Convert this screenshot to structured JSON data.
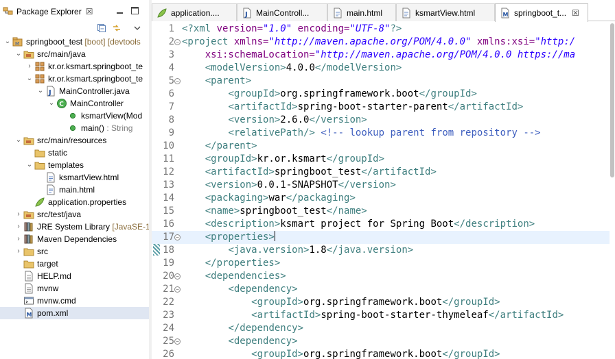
{
  "colors": {
    "tag": "#3f7f7f",
    "attr_name": "#7f007f",
    "attr_value": "#2a00ff",
    "comment": "#3f5fbf",
    "text": "#000000",
    "decoration": "#8a6d3b",
    "line_number": "#787878",
    "current_line": "#e8f2fe",
    "selected_row": "#dfe6f2"
  },
  "explorer": {
    "title": "Package Explorer",
    "close": "☒",
    "view_menu_icon": "view-menu-icon",
    "minimize_icon": "minimize-icon",
    "maximize_icon": "maximize-icon",
    "toolbar": {
      "collapse_all_icon": "collapse-all-icon",
      "link_editor_icon": "link-with-editor-icon",
      "menu_icon": "view-dropdown-icon"
    },
    "tree": [
      {
        "label": "springboot_test",
        "deco": " [boot] [devtools",
        "icon": "project-icon",
        "depth": 0,
        "twisty": "open"
      },
      {
        "label": "src/main/java",
        "icon": "source-folder-icon",
        "depth": 1,
        "twisty": "open"
      },
      {
        "label": "kr.or.ksmart.springboot_te",
        "icon": "package-icon",
        "depth": 2,
        "twisty": "closed"
      },
      {
        "label": "kr.or.ksmart.springboot_te",
        "icon": "package-icon",
        "depth": 2,
        "twisty": "open"
      },
      {
        "label": "MainController.java",
        "icon": "java-file-icon",
        "depth": 3,
        "twisty": "open"
      },
      {
        "label": "MainController",
        "icon": "class-icon",
        "depth": 4,
        "twisty": "open"
      },
      {
        "label": "ksmartView(Mod",
        "icon": "public-method-icon",
        "depth": 5,
        "twisty": "none"
      },
      {
        "label": "main()",
        "deco": " : String",
        "icon": "public-method-icon",
        "depth": 5,
        "twisty": "none"
      },
      {
        "label": "src/main/resources",
        "icon": "source-folder-icon",
        "depth": 1,
        "twisty": "open"
      },
      {
        "label": "static",
        "icon": "folder-icon",
        "depth": 2,
        "twisty": "none"
      },
      {
        "label": "templates",
        "icon": "folder-icon",
        "depth": 2,
        "twisty": "open"
      },
      {
        "label": "ksmartView.html",
        "icon": "html-file-icon",
        "depth": 3,
        "twisty": "none"
      },
      {
        "label": "main.html",
        "icon": "html-file-icon",
        "depth": 3,
        "twisty": "none"
      },
      {
        "label": "application.properties",
        "icon": "properties-file-icon",
        "depth": 2,
        "twisty": "none"
      },
      {
        "label": "src/test/java",
        "icon": "source-folder-icon",
        "depth": 1,
        "twisty": "closed"
      },
      {
        "label": "JRE System Library",
        "deco": " [JavaSE-1",
        "icon": "library-icon",
        "depth": 1,
        "twisty": "closed"
      },
      {
        "label": "Maven Dependencies",
        "icon": "library-icon",
        "depth": 1,
        "twisty": "closed"
      },
      {
        "label": "src",
        "icon": "folder-icon",
        "depth": 1,
        "twisty": "closed"
      },
      {
        "label": "target",
        "icon": "folder-icon",
        "depth": 1,
        "twisty": "none"
      },
      {
        "label": "HELP.md",
        "icon": "text-file-icon",
        "depth": 1,
        "twisty": "none"
      },
      {
        "label": "mvnw",
        "icon": "text-file-icon",
        "depth": 1,
        "twisty": "none"
      },
      {
        "label": "mvnw.cmd",
        "icon": "cmd-file-icon",
        "depth": 1,
        "twisty": "none"
      },
      {
        "label": "pom.xml",
        "icon": "xml-file-icon",
        "depth": 1,
        "twisty": "none",
        "selected": true
      }
    ]
  },
  "editor": {
    "tabs": [
      {
        "label": "application....",
        "icon": "properties-file-icon",
        "active": false
      },
      {
        "label": "MainControll...",
        "icon": "java-file-icon",
        "active": false
      },
      {
        "label": "main.html",
        "icon": "html-file-icon",
        "active": false
      },
      {
        "label": "ksmartView.html",
        "icon": "html-file-icon",
        "active": false
      },
      {
        "label": "springboot_t...",
        "icon": "xml-file-icon",
        "active": true,
        "close": "☒"
      }
    ],
    "current_line": 17,
    "lines": [
      {
        "n": "1",
        "fold": "",
        "tokens": [
          [
            "pi",
            "<?xml "
          ],
          [
            "an",
            "version="
          ],
          [
            "av",
            "\"1.0\""
          ],
          [
            "pi",
            " "
          ],
          [
            "an",
            "encoding="
          ],
          [
            "av",
            "\"UTF-8\""
          ],
          [
            "pi",
            "?>"
          ]
        ]
      },
      {
        "n": "2",
        "fold": "−",
        "tokens": [
          [
            "tag",
            "<project "
          ],
          [
            "an",
            "xmlns="
          ],
          [
            "av",
            "\"http://maven.apache.org/POM/4.0.0\""
          ],
          [
            "t",
            " "
          ],
          [
            "an",
            "xmlns:xsi="
          ],
          [
            "av",
            "\"http:/"
          ]
        ]
      },
      {
        "n": "3",
        "fold": "",
        "tokens": [
          [
            "t",
            "    "
          ],
          [
            "an",
            "xsi:schemaLocation="
          ],
          [
            "av",
            "\"http://maven.apache.org/POM/4.0.0 https://ma"
          ]
        ]
      },
      {
        "n": "4",
        "fold": "",
        "tokens": [
          [
            "t",
            "    "
          ],
          [
            "tag",
            "<modelVersion>"
          ],
          [
            "t",
            "4.0.0"
          ],
          [
            "tag",
            "</modelVersion>"
          ]
        ]
      },
      {
        "n": "5",
        "fold": "−",
        "tokens": [
          [
            "t",
            "    "
          ],
          [
            "tag",
            "<parent>"
          ]
        ]
      },
      {
        "n": "6",
        "fold": "",
        "tokens": [
          [
            "t",
            "        "
          ],
          [
            "tag",
            "<groupId>"
          ],
          [
            "t",
            "org.springframework.boot"
          ],
          [
            "tag",
            "</groupId>"
          ]
        ]
      },
      {
        "n": "7",
        "fold": "",
        "tokens": [
          [
            "t",
            "        "
          ],
          [
            "tag",
            "<artifactId>"
          ],
          [
            "t",
            "spring-boot-starter-parent"
          ],
          [
            "tag",
            "</artifactId>"
          ]
        ]
      },
      {
        "n": "8",
        "fold": "",
        "tokens": [
          [
            "t",
            "        "
          ],
          [
            "tag",
            "<version>"
          ],
          [
            "t",
            "2.6.0"
          ],
          [
            "tag",
            "</version>"
          ]
        ]
      },
      {
        "n": "9",
        "fold": "",
        "tokens": [
          [
            "t",
            "        "
          ],
          [
            "tag",
            "<relativePath/>"
          ],
          [
            "t",
            " "
          ],
          [
            "cm",
            "<!-- lookup parent from repository -->"
          ]
        ]
      },
      {
        "n": "10",
        "fold": "",
        "tokens": [
          [
            "t",
            "    "
          ],
          [
            "tag",
            "</parent>"
          ]
        ]
      },
      {
        "n": "11",
        "fold": "",
        "tokens": [
          [
            "t",
            "    "
          ],
          [
            "tag",
            "<groupId>"
          ],
          [
            "t",
            "kr.or.ksmart"
          ],
          [
            "tag",
            "</groupId>"
          ]
        ]
      },
      {
        "n": "12",
        "fold": "",
        "tokens": [
          [
            "t",
            "    "
          ],
          [
            "tag",
            "<artifactId>"
          ],
          [
            "t",
            "springboot_test"
          ],
          [
            "tag",
            "</artifactId>"
          ]
        ]
      },
      {
        "n": "13",
        "fold": "",
        "tokens": [
          [
            "t",
            "    "
          ],
          [
            "tag",
            "<version>"
          ],
          [
            "t",
            "0.0.1-SNAPSHOT"
          ],
          [
            "tag",
            "</version>"
          ]
        ]
      },
      {
        "n": "14",
        "fold": "",
        "tokens": [
          [
            "t",
            "    "
          ],
          [
            "tag",
            "<packaging>"
          ],
          [
            "t",
            "war"
          ],
          [
            "tag",
            "</packaging>"
          ]
        ]
      },
      {
        "n": "15",
        "fold": "",
        "tokens": [
          [
            "t",
            "    "
          ],
          [
            "tag",
            "<name>"
          ],
          [
            "t",
            "springboot_test"
          ],
          [
            "tag",
            "</name>"
          ]
        ]
      },
      {
        "n": "16",
        "fold": "",
        "tokens": [
          [
            "t",
            "    "
          ],
          [
            "tag",
            "<description>"
          ],
          [
            "t",
            "ksmart project for Spring Boot"
          ],
          [
            "tag",
            "</description>"
          ]
        ]
      },
      {
        "n": "17",
        "fold": "−",
        "tokens": [
          [
            "t",
            "    "
          ],
          [
            "tag",
            "<properties>"
          ]
        ],
        "cursor": true
      },
      {
        "n": "18",
        "fold": "",
        "tokens": [
          [
            "t",
            "        "
          ],
          [
            "tag",
            "<java.version>"
          ],
          [
            "t",
            "1.8"
          ],
          [
            "tag",
            "</java.version>"
          ]
        ]
      },
      {
        "n": "19",
        "fold": "",
        "tokens": [
          [
            "t",
            "    "
          ],
          [
            "tag",
            "</properties>"
          ]
        ]
      },
      {
        "n": "20",
        "fold": "−",
        "tokens": [
          [
            "t",
            "    "
          ],
          [
            "tag",
            "<dependencies>"
          ]
        ]
      },
      {
        "n": "21",
        "fold": "−",
        "tokens": [
          [
            "t",
            "        "
          ],
          [
            "tag",
            "<dependency>"
          ]
        ]
      },
      {
        "n": "22",
        "fold": "",
        "tokens": [
          [
            "t",
            "            "
          ],
          [
            "tag",
            "<groupId>"
          ],
          [
            "t",
            "org.springframework.boot"
          ],
          [
            "tag",
            "</groupId>"
          ]
        ]
      },
      {
        "n": "23",
        "fold": "",
        "tokens": [
          [
            "t",
            "            "
          ],
          [
            "tag",
            "<artifactId>"
          ],
          [
            "t",
            "spring-boot-starter-thymeleaf"
          ],
          [
            "tag",
            "</artifactId>"
          ]
        ]
      },
      {
        "n": "24",
        "fold": "",
        "tokens": [
          [
            "t",
            "        "
          ],
          [
            "tag",
            "</dependency>"
          ]
        ]
      },
      {
        "n": "25",
        "fold": "−",
        "tokens": [
          [
            "t",
            "        "
          ],
          [
            "tag",
            "<dependency>"
          ]
        ]
      },
      {
        "n": "26",
        "fold": "",
        "tokens": [
          [
            "t",
            "            "
          ],
          [
            "tag",
            "<groupId>"
          ],
          [
            "t",
            "org.springframework.boot"
          ],
          [
            "tag",
            "</groupId>"
          ]
        ]
      }
    ]
  }
}
